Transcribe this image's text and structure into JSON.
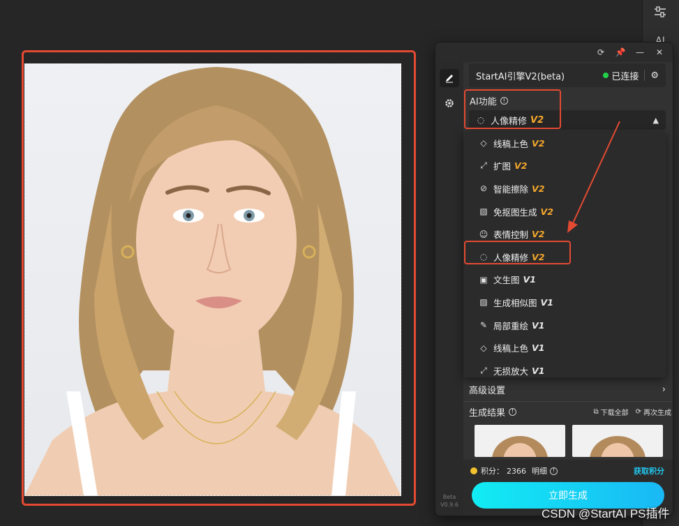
{
  "panel": {
    "engine_name": "StartAI引擎V2(beta)",
    "status": "已连接",
    "ai_label": "AI功能",
    "selected": {
      "label": "人像精修",
      "version": "V2"
    },
    "dropdown": [
      {
        "icon": "line-art-icon",
        "label": "线稿上色",
        "version": "V2"
      },
      {
        "icon": "expand-icon",
        "label": "扩图",
        "version": "V2"
      },
      {
        "icon": "eraser-icon",
        "label": "智能擦除",
        "version": "V2"
      },
      {
        "icon": "cutout-icon",
        "label": "免抠图生成",
        "version": "V2"
      },
      {
        "icon": "smile-icon",
        "label": "表情控制",
        "version": "V2"
      },
      {
        "icon": "portrait-icon",
        "label": "人像精修",
        "version": "V2"
      },
      {
        "icon": "image-text-icon",
        "label": "文生图",
        "version": "V1"
      },
      {
        "icon": "similar-image-icon",
        "label": "生成相似图",
        "version": "V1"
      },
      {
        "icon": "brush-icon",
        "label": "局部重绘",
        "version": "V1"
      },
      {
        "icon": "line-art-icon",
        "label": "线稿上色",
        "version": "V1"
      },
      {
        "icon": "upscale-icon",
        "label": "无损放大",
        "version": "V1"
      }
    ],
    "advanced": "高级设置",
    "results_label": "生成结果",
    "download_all": "下载全部",
    "regenerate": "再次生成",
    "credits_label": "积分：",
    "credits_value": "2366",
    "details": "明细",
    "get_credits": "获取积分",
    "generate": "立即生成",
    "version_beta": "Beta",
    "version_num": "V0.9.6"
  },
  "edge_strip": {
    "label": "AI"
  },
  "watermark": "CSDN @StartAI PS插件",
  "colors": {
    "accent_red": "#e44a32",
    "v2_orange": "#f4a72c",
    "cta_cyan": "#12ecf3",
    "status_green": "#22d04a"
  }
}
